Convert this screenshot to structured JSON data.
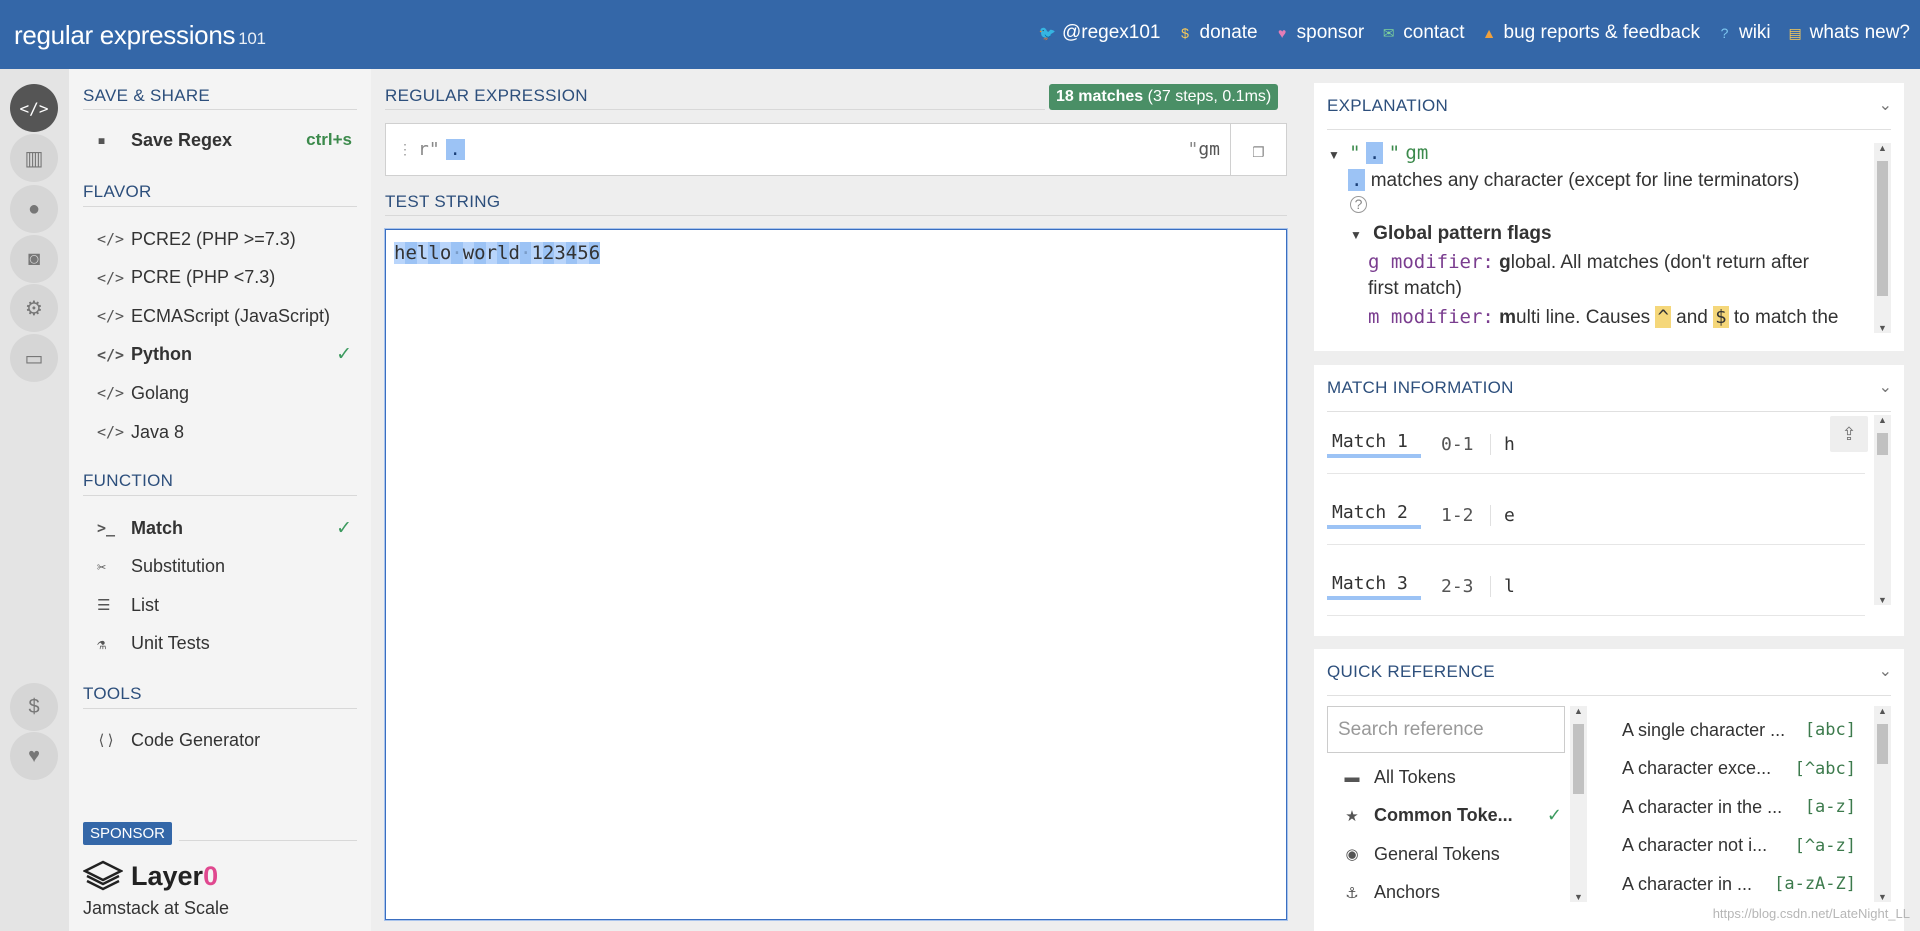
{
  "header": {
    "logo_main": "regular expressions",
    "logo_version": "101",
    "nav": [
      {
        "label": "@regex101",
        "icon": "twitter-icon",
        "glyph": "🐦",
        "color": "#6ab7f0"
      },
      {
        "label": "donate",
        "icon": "dollar-icon",
        "glyph": "$",
        "color": "#f5c85a"
      },
      {
        "label": "sponsor",
        "icon": "heart-icon",
        "glyph": "♥",
        "color": "#e47db6"
      },
      {
        "label": "contact",
        "icon": "envelope-icon",
        "glyph": "✉",
        "color": "#7ed39a"
      },
      {
        "label": "bug reports & feedback",
        "icon": "warning-icon",
        "glyph": "▲",
        "color": "#f0a03c"
      },
      {
        "label": "wiki",
        "icon": "question-icon",
        "glyph": "?",
        "color": "#7cc6f0"
      },
      {
        "label": "whats new?",
        "icon": "news-icon",
        "glyph": "▤",
        "color": "#f5c85a"
      }
    ]
  },
  "rail": [
    {
      "icon": "code-icon",
      "glyph": "</>",
      "active": true
    },
    {
      "icon": "library-icon",
      "glyph": "▥",
      "active": false
    },
    {
      "icon": "user-icon",
      "glyph": "●",
      "active": false
    },
    {
      "icon": "gamepad-icon",
      "glyph": "◙",
      "active": false
    },
    {
      "icon": "settings-icon",
      "glyph": "⚙",
      "active": false
    },
    {
      "icon": "chat-icon",
      "glyph": "▭",
      "active": false
    },
    {
      "icon": "dollar-icon",
      "glyph": "$",
      "active": false
    },
    {
      "icon": "heart-icon",
      "glyph": "♥",
      "active": false
    }
  ],
  "sidebar": {
    "save_title": "SAVE & SHARE",
    "save_label": "Save Regex",
    "save_shortcut": "ctrl+s",
    "flavor_title": "FLAVOR",
    "flavors": [
      "PCRE2 (PHP >=7.3)",
      "PCRE (PHP <7.3)",
      "ECMAScript (JavaScript)",
      "Python",
      "Golang",
      "Java 8"
    ],
    "selected_flavor": "Python",
    "function_title": "FUNCTION",
    "functions": [
      {
        "label": "Match",
        "icon": "terminal-icon",
        "glyph": ">_",
        "selected": true
      },
      {
        "label": "Substitution",
        "icon": "scissors-icon",
        "glyph": "✂",
        "selected": false
      },
      {
        "label": "List",
        "icon": "list-icon",
        "glyph": "☰",
        "selected": false
      },
      {
        "label": "Unit Tests",
        "icon": "flask-icon",
        "glyph": "⚗",
        "selected": false
      }
    ],
    "tools_title": "TOOLS",
    "tools": [
      {
        "label": "Code Generator",
        "icon": "code-file-icon",
        "glyph": "⟨⟩"
      }
    ],
    "sponsor_badge": "SPONSOR",
    "sponsor_name": "Layer",
    "sponsor_zero": "0",
    "sponsor_tagline": "Jamstack at Scale"
  },
  "regex": {
    "title": "REGULAR EXPRESSION",
    "match_count": "18 matches",
    "match_detail": " (37 steps, 0.1ms)",
    "prefix": "r\"",
    "pattern": ".",
    "suffix": "\"",
    "flags": "gm"
  },
  "test_string": {
    "title": "TEST STRING",
    "value": "hello world 123456"
  },
  "explanation": {
    "title": "EXPLANATION",
    "line1_quote_open": "\"",
    "line1_token": ".",
    "line1_quote_close": "\"",
    "line1_flags": "gm",
    "line2_token": ".",
    "line2_text": "matches any character (except for line terminators)",
    "flags_header": "Global pattern flags",
    "g_mod": "g modifier:",
    "g_bold": "g",
    "g_text": "lobal. All matches (don't return after",
    "g_text2": "first match)",
    "m_mod": "m modifier:",
    "m_bold": "m",
    "m_text": "ulti line. Causes",
    "m_caret": "^",
    "m_and": "and",
    "m_dollar": "$",
    "m_tail": "to match the"
  },
  "match_info": {
    "title": "MATCH INFORMATION",
    "rows": [
      {
        "label": "Match 1",
        "range": "0-1",
        "value": "h"
      },
      {
        "label": "Match 2",
        "range": "1-2",
        "value": "e"
      },
      {
        "label": "Match 3",
        "range": "2-3",
        "value": "l"
      }
    ]
  },
  "quick_reference": {
    "title": "QUICK REFERENCE",
    "search_placeholder": "Search reference",
    "categories": [
      {
        "label": "All Tokens",
        "icon": "stack-icon",
        "glyph": "▬",
        "selected": false
      },
      {
        "label": "Common Toke...",
        "icon": "star-icon",
        "glyph": "★",
        "selected": true
      },
      {
        "label": "General Tokens",
        "icon": "circle-dot-icon",
        "glyph": "◉",
        "selected": false
      },
      {
        "label": "Anchors",
        "icon": "anchor-icon",
        "glyph": "⚓",
        "selected": false
      }
    ],
    "entries": [
      {
        "desc": "A single character ...",
        "token": "[abc]"
      },
      {
        "desc": "A character exce...",
        "token": "[^abc]"
      },
      {
        "desc": "A character in the ...",
        "token": "[a-z]"
      },
      {
        "desc": "A character not i...",
        "token": "[^a-z]"
      },
      {
        "desc": "A character in ...",
        "token": "[a-zA-Z]"
      }
    ]
  },
  "watermark": "https://blog.csdn.net/LateNight_LL"
}
